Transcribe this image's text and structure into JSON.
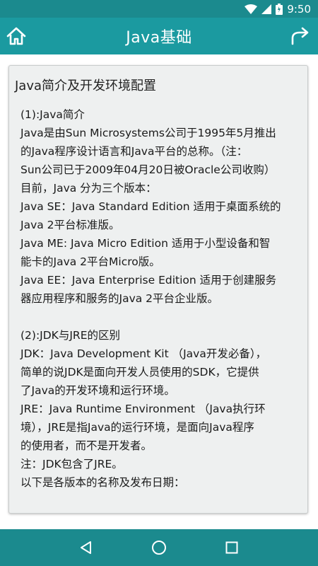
{
  "status_bar": {
    "time": "9:50",
    "icons": [
      "wifi-icon",
      "cell-signal-icon",
      "battery-icon"
    ]
  },
  "app_bar": {
    "title": "Java基础",
    "left_icon": "home-icon",
    "right_icon": "share-icon"
  },
  "article": {
    "title": "Java简介及开发环境配置",
    "lines": [
      "(1):Java简介",
      "Java是由Sun Microsystems公司于1995年5月推出",
      "的Java程序设计语言和Java平台的总称。（注：",
      "Sun公司已于2009年04月20日被Oracle公司收购）",
      "目前，Java 分为三个版本：",
      "Java SE：Java Standard Edition 适用于桌面系统的",
      "Java 2平台标准版。",
      "Java ME: Java Micro Edition 适用于小型设备和智",
      "能卡的Java 2平台Micro版。",
      "Java EE：Java Enterprise Edition 适用于创建服务",
      "器应用程序和服务的Java 2平台企业版。",
      "",
      "(2):JDK与JRE的区别",
      "JDK：Java Development Kit （Java开发必备），",
      "简单的说JDK是面向开发人员使用的SDK，它提供",
      "了Java的开发环境和运行环境。",
      "JRE：Java Runtime Environment （Java执行环",
      "境），JRE是指Java的运行环境，是面向Java程序",
      "的使用者，而不是开发者。",
      "注：JDK包含了JRE。",
      "以下是各版本的名称及发布日期："
    ]
  },
  "nav_bar": {
    "buttons": [
      "back-icon",
      "home-circle-icon",
      "recents-icon"
    ]
  },
  "colors": {
    "primary": "#1b9aa0",
    "primary_dark": "#1b8a8e",
    "card_bg": "#eef0f0"
  }
}
